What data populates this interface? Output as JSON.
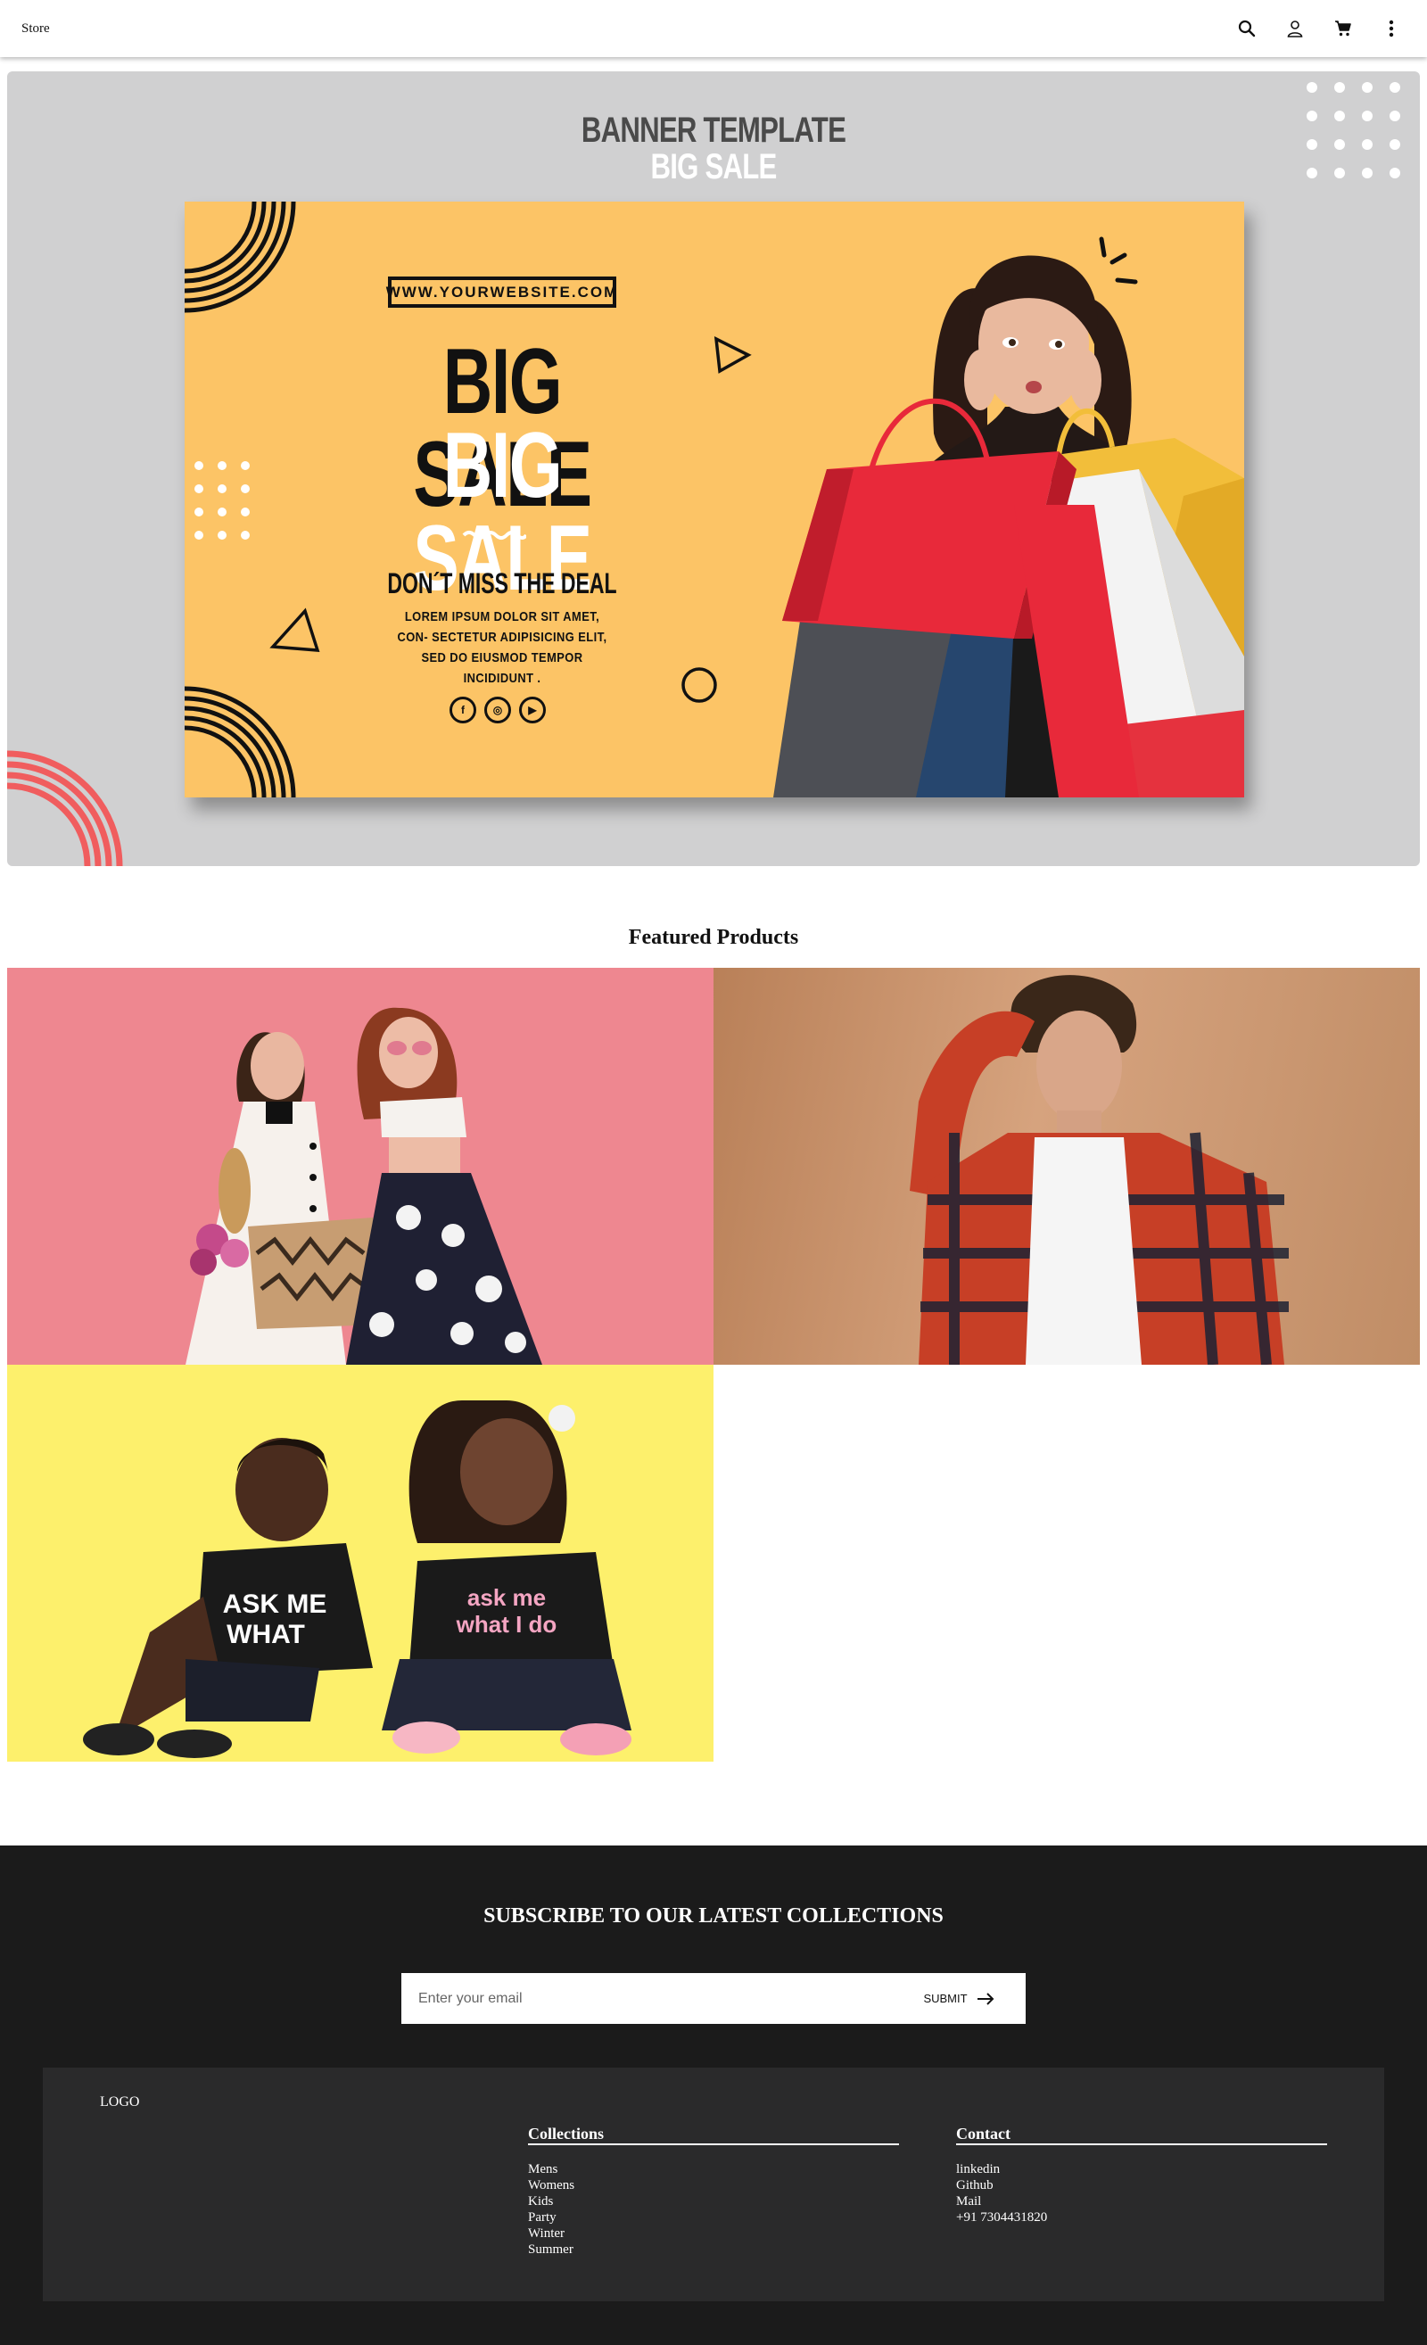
{
  "header": {
    "brand": "Store",
    "icons": [
      "search-icon",
      "user-icon",
      "cart-icon",
      "more-vertical-icon"
    ]
  },
  "banner": {
    "heading_line1": "BANNER TEMPLATE",
    "heading_line2": "BIG SALE",
    "poster": {
      "website": "WWW.YOURWEBSITE.COM",
      "sale_line1": "BIG SALE",
      "sale_line2": "BIG SALE",
      "deal": "DON´T MISS THE DEAL",
      "description": "LOREM IPSUM DOLOR SIT AMET, CON- SECTETUR ADIPISICING ELIT, SED DO EIUSMOD TEMPOR INCIDIDUNT .",
      "social_icons": [
        "facebook-icon",
        "instagram-icon",
        "youtube-icon"
      ],
      "social_glyphs": [
        "f",
        "◎",
        "▶"
      ]
    },
    "colors": {
      "background": "#d0d0d1",
      "poster": "#fcc466",
      "accent_red": "#e8414c",
      "arc_coral": "#f05d5e"
    }
  },
  "featured": {
    "title": "Featured Products",
    "products": [
      {
        "subject": "women",
        "background": "#ee8790"
      },
      {
        "subject": "men",
        "background": "#c99670"
      },
      {
        "subject": "kids",
        "background": "#fdf06c"
      }
    ]
  },
  "footer": {
    "subscribe_title": "SUBSCRIBE TO OUR LATEST COLLECTIONS",
    "email_placeholder": "Enter your email",
    "submit_label": "SUBMIT",
    "logo": "LOGO",
    "collections": {
      "heading": "Collections",
      "items": [
        "Mens",
        "Womens",
        "Kids",
        "Party",
        "Winter",
        "Summer"
      ]
    },
    "contact": {
      "heading": "Contact",
      "items": [
        "linkedin",
        "Github",
        "Mail",
        "+91 7304431820"
      ]
    }
  }
}
